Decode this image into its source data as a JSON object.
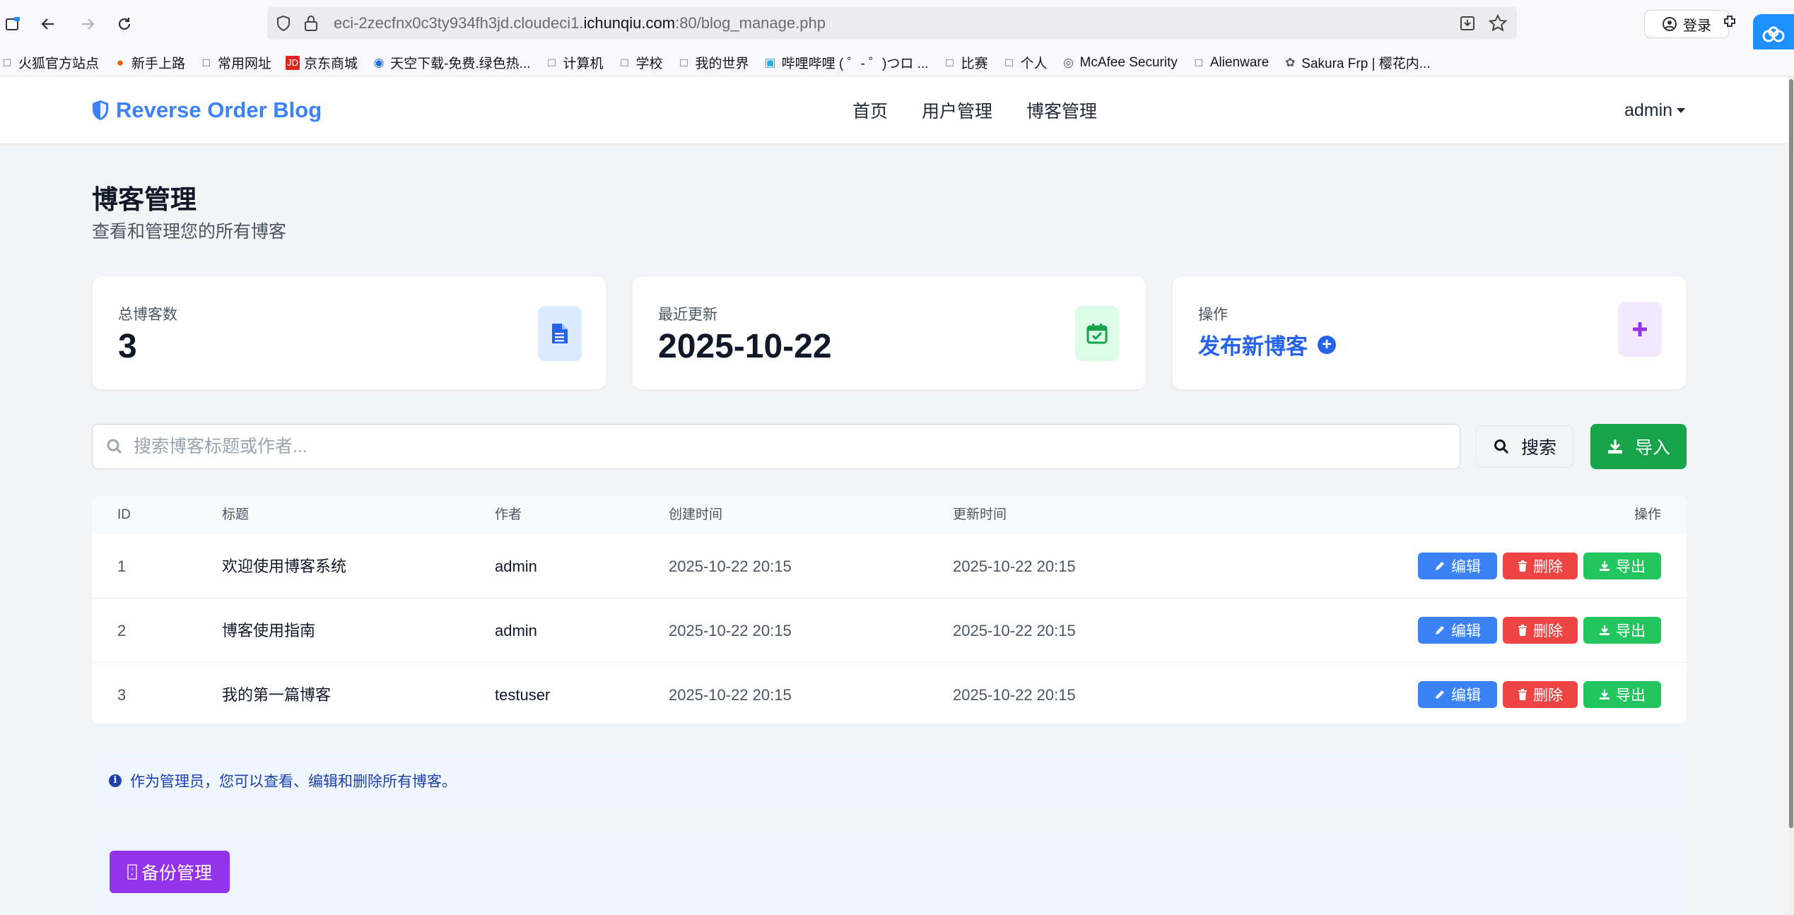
{
  "browser": {
    "url_prefix": "eci-2zecfnx0c3ty934fh3jd.cloudeci1.",
    "url_domain": "ichunqiu.com",
    "url_suffix": ":80/blog_manage.php",
    "login_label": "登录",
    "bookmarks": [
      {
        "label": "火狐官方站点",
        "icon": "folder-icon"
      },
      {
        "label": "新手上路",
        "icon": "firefox-icon"
      },
      {
        "label": "常用网址",
        "icon": "folder-icon"
      },
      {
        "label": "京东商城",
        "icon": "jd-icon"
      },
      {
        "label": "天空下载-免费.绿色热...",
        "icon": "download-site-icon"
      },
      {
        "label": "计算机",
        "icon": "folder-icon"
      },
      {
        "label": "学校",
        "icon": "folder-icon"
      },
      {
        "label": "我的世界",
        "icon": "folder-icon"
      },
      {
        "label": "哔哩哔哩 ( ゜- ゜)つロ ...",
        "icon": "bilibili-icon"
      },
      {
        "label": "比赛",
        "icon": "folder-icon"
      },
      {
        "label": "个人",
        "icon": "folder-icon"
      },
      {
        "label": "McAfee Security",
        "icon": "globe-icon"
      },
      {
        "label": "Alienware",
        "icon": "folder-icon"
      },
      {
        "label": "Sakura Frp | 樱花内...",
        "icon": "sakura-icon"
      }
    ]
  },
  "header": {
    "brand": "Reverse Order Blog",
    "nav": [
      "首页",
      "用户管理",
      "博客管理"
    ],
    "user": "admin"
  },
  "page": {
    "title": "博客管理",
    "subtitle": "查看和管理您的所有博客"
  },
  "stats": {
    "total_label": "总博客数",
    "total_value": "3",
    "updated_label": "最近更新",
    "updated_value": "2025-10-22",
    "action_label": "操作",
    "action_value": "发布新博客"
  },
  "search": {
    "placeholder": "搜索博客标题或作者...",
    "button": "搜索",
    "import": "导入"
  },
  "table": {
    "headers": [
      "ID",
      "标题",
      "作者",
      "创建时间",
      "更新时间",
      "操作"
    ],
    "rows": [
      {
        "id": "1",
        "title": "欢迎使用博客系统",
        "author": "admin",
        "created": "2025-10-22 20:15",
        "updated": "2025-10-22 20:15"
      },
      {
        "id": "2",
        "title": "博客使用指南",
        "author": "admin",
        "created": "2025-10-22 20:15",
        "updated": "2025-10-22 20:15"
      },
      {
        "id": "3",
        "title": "我的第一篇博客",
        "author": "testuser",
        "created": "2025-10-22 20:15",
        "updated": "2025-10-22 20:15"
      }
    ],
    "actions": {
      "edit": "编辑",
      "delete": "删除",
      "export": "导出"
    }
  },
  "info": "作为管理员，您可以查看、编辑和删除所有博客。",
  "backup": {
    "button": "备份管理"
  },
  "colors": {
    "brand": "#3b82f6",
    "edit": "#3b82f6",
    "delete": "#ef4444",
    "export": "#22c55e",
    "import": "#16a34a",
    "backup": "#9333ea"
  }
}
